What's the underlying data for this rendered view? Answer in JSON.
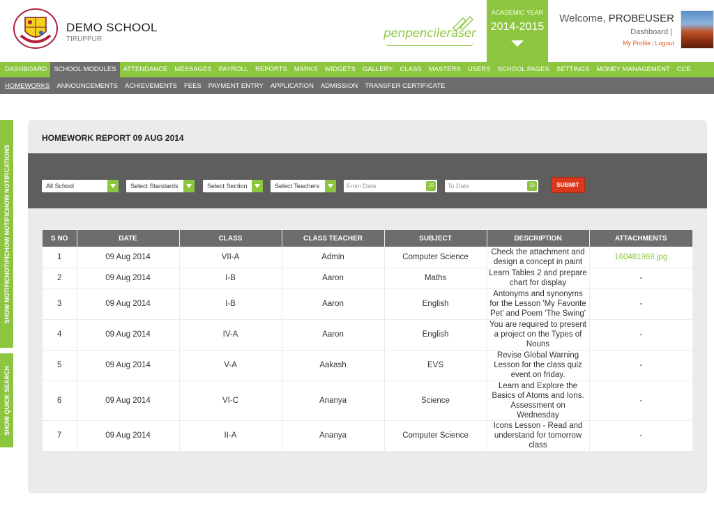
{
  "header": {
    "school_name": "DEMO SCHOOL",
    "school_city": "TIRUPPUR",
    "brand": "penpencileraser",
    "academic_year_label": "ACADEMIC YEAR",
    "academic_year": "2014-2015",
    "welcome_prefix": "Welcome, ",
    "username": "PROBEUSER",
    "dashboard_link": "Dashboard |",
    "my_profile": "My Profile",
    "profile_sep": "|",
    "logout": "Logout"
  },
  "nav_main": [
    {
      "label": "DASHBOARD"
    },
    {
      "label": "SCHOOL MODULES",
      "active": true
    },
    {
      "label": "ATTENDANCE"
    },
    {
      "label": "MESSAGES"
    },
    {
      "label": "PAYROLL"
    },
    {
      "label": "REPORTS"
    },
    {
      "label": "MARKS"
    },
    {
      "label": "WIDGETS"
    },
    {
      "label": "GALLERY"
    },
    {
      "label": "CLASS"
    },
    {
      "label": "MASTERS"
    },
    {
      "label": "USERS"
    },
    {
      "label": "SCHOOL PAGES"
    },
    {
      "label": "SETTINGS"
    },
    {
      "label": "MONEY MANAGEMENT"
    },
    {
      "label": "CCE"
    }
  ],
  "nav_sub": [
    {
      "label": "HOMEWORKS",
      "active": true
    },
    {
      "label": "ANNOUNCEMENTS"
    },
    {
      "label": "ACHIEVEMENTS"
    },
    {
      "label": "FEES"
    },
    {
      "label": "PAYMENT ENTRY"
    },
    {
      "label": "APPLICATION"
    },
    {
      "label": "ADMISSION"
    },
    {
      "label": "TRANSFER CERTIFICATE"
    }
  ],
  "side_tabs": {
    "notifications": "SHOW NOTIFICNOTIFICHOW NOTIFICHOW NOTIFICATIONS",
    "quick_search": "SHOW QUICK SEARCH"
  },
  "report": {
    "title": "HOMEWORK REPORT 09 AUG 2014",
    "filters": {
      "school": "All School",
      "standards": "Select Standards",
      "section": "Select Section",
      "teachers": "Select Teachers",
      "from_date_placeholder": "From Date",
      "to_date_placeholder": "To Date",
      "calendar_icon_text": "10",
      "submit": "SUBMIT"
    },
    "columns": [
      "S NO",
      "DATE",
      "CLASS",
      "CLASS TEACHER",
      "SUBJECT",
      "DESCRIPTION",
      "ATTACHMENTS"
    ],
    "rows": [
      {
        "sno": "1",
        "date": "09 Aug 2014",
        "class": "VII-A",
        "teacher": "Admin",
        "subject": "Computer Science",
        "description": "Check the attachment and design a concept in paint",
        "attachment": "160481969.jpg"
      },
      {
        "sno": "2",
        "date": "09 Aug 2014",
        "class": "I-B",
        "teacher": "Aaron",
        "subject": "Maths",
        "description": "Learn Tables 2 and prepare chart for display",
        "attachment": "-"
      },
      {
        "sno": "3",
        "date": "09 Aug 2014",
        "class": "I-B",
        "teacher": "Aaron",
        "subject": "English",
        "description": "Antonyms and synonyms for the Lesson 'My Favorite Pet' and Poem 'The Swing'",
        "attachment": "-"
      },
      {
        "sno": "4",
        "date": "09 Aug 2014",
        "class": "IV-A",
        "teacher": "Aaron",
        "subject": "English",
        "description": "You are required to present a project on the Types of Nouns",
        "attachment": "-"
      },
      {
        "sno": "5",
        "date": "09 Aug 2014",
        "class": "V-A",
        "teacher": "Aakash",
        "subject": "EVS",
        "description": "Revise Global Warning Lesson for the class quiz event on friday.",
        "attachment": "-"
      },
      {
        "sno": "6",
        "date": "09 Aug 2014",
        "class": "VI-C",
        "teacher": "Ananya",
        "subject": "Science",
        "description": "Learn and Explore the Basics of Atoms and Ions. Assessment on Wednesday",
        "attachment": "-"
      },
      {
        "sno": "7",
        "date": "09 Aug 2014",
        "class": "II-A",
        "teacher": "Ananya",
        "subject": "Computer Science",
        "description": "Icons Lesson - Read and understand for tomorrow class",
        "attachment": "-"
      }
    ]
  },
  "colors": {
    "accent_green": "#8cc63f",
    "nav_gray": "#6d6d6d",
    "submit_red": "#d9381e",
    "link_orange": "#e05a2a"
  }
}
